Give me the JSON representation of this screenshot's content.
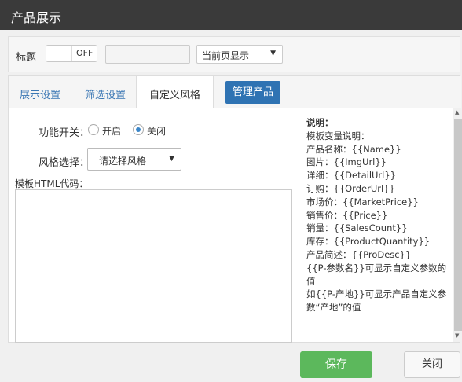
{
  "window": {
    "title": "产品展示"
  },
  "toolbar": {
    "title_label": "标题",
    "switch_state": "OFF",
    "title_value": "",
    "display_select": "当前页显示"
  },
  "tabs": [
    {
      "label": "展示设置"
    },
    {
      "label": "筛选设置"
    },
    {
      "label": "自定义风格"
    }
  ],
  "manage_button": "管理产品",
  "form": {
    "feature_switch_label": "功能开关：",
    "radio_on": "开启",
    "radio_off": "关闭",
    "selected": "关闭",
    "style_label": "风格选择：",
    "style_select": "请选择风格",
    "template_label": "模板HTML代码：",
    "template_value": ""
  },
  "help": {
    "heading": "说明：",
    "lines": [
      "模板变量说明：",
      "产品名称：{{Name}}",
      "图片：{{ImgUrl}}",
      "详细：{{DetailUrl}}",
      "订购：{{OrderUrl}}",
      "市场价：{{MarketPrice}}",
      "销售价：{{Price}}",
      "销量：{{SalesCount}}",
      "库存：{{ProductQuantity}}",
      "产品简述：{{ProDesc}}",
      "{{P-参数名}}可显示自定义参数的",
      "值",
      "如{{P-产地}}可显示产品自定义参",
      "数“产地”的值"
    ]
  },
  "footer": {
    "save": "保存",
    "close": "关闭"
  },
  "colors": {
    "titlebar": "#3a3a3a",
    "primary": "#2f73b3",
    "save": "#5cb85c"
  }
}
